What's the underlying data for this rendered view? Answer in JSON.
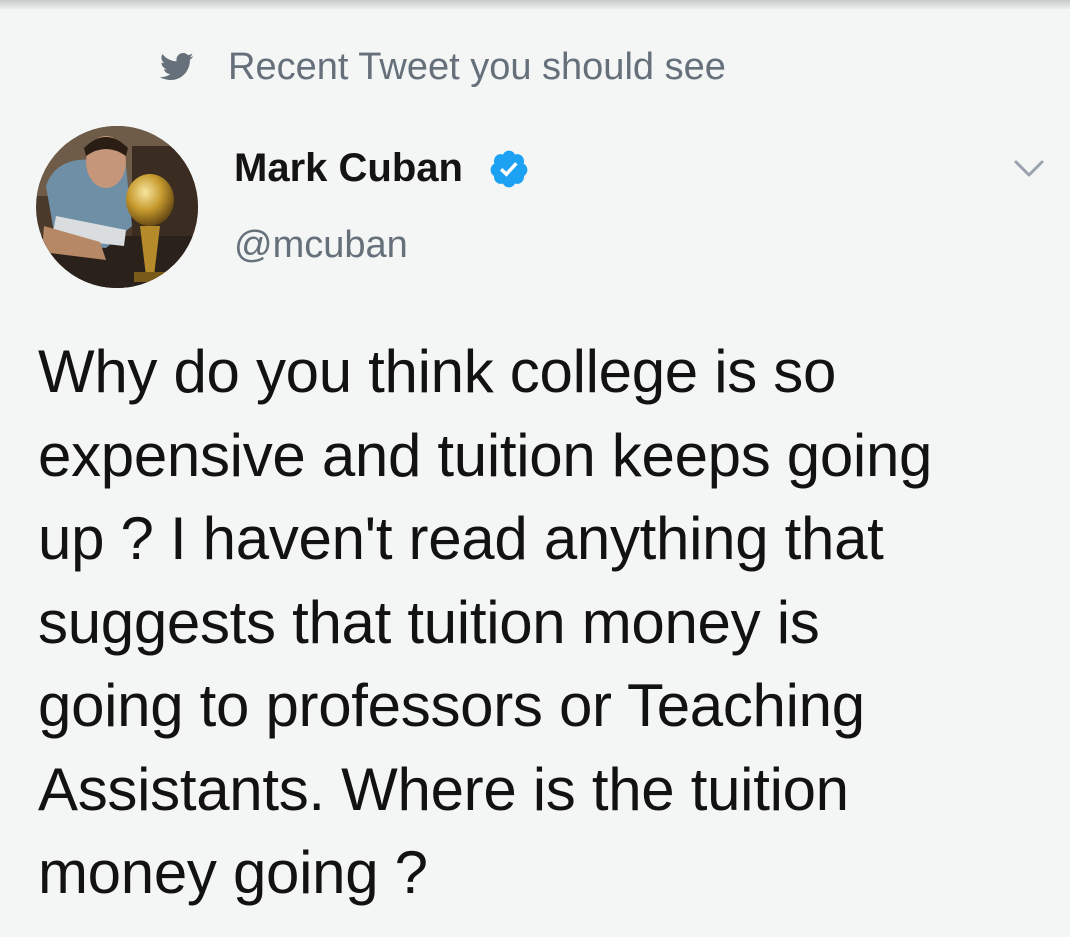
{
  "context": {
    "icon": "twitter-bird-icon",
    "label": "Recent Tweet you should see"
  },
  "author": {
    "name": "Mark Cuban",
    "handle": "@mcuban",
    "verified": true
  },
  "tweet": {
    "text": "Why do you think college is so\nexpensive and tuition keeps going\nup ? I haven't read anything that\nsuggests that tuition money is\ngoing to professors or Teaching\nAssistants.  Where is the tuition\nmoney going ?"
  },
  "colors": {
    "accent": "#1da1f2",
    "secondary_text": "#66707a",
    "background": "#f4f5f5"
  }
}
